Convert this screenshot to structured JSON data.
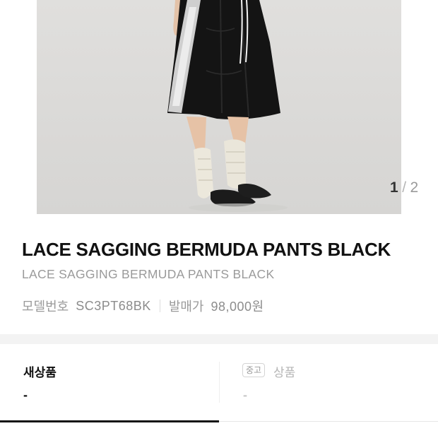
{
  "gallery": {
    "current": "1",
    "separator": "/",
    "total": "2"
  },
  "product": {
    "title": "LACE SAGGING BERMUDA PANTS BLACK",
    "subtitle": "LACE SAGGING BERMUDA PANTS BLACK",
    "model_label": "모델번호",
    "model_value": "SC3PT68BK",
    "release_label": "발매가",
    "release_value": "98,000원"
  },
  "tabs": {
    "new": {
      "label": "새상품",
      "price": "-"
    },
    "used": {
      "badge": "중고",
      "label": "상품",
      "price": "-"
    }
  },
  "colors": {
    "accent": "#111111",
    "muted": "#9a9a9a",
    "photo_bg": "#dedede"
  }
}
